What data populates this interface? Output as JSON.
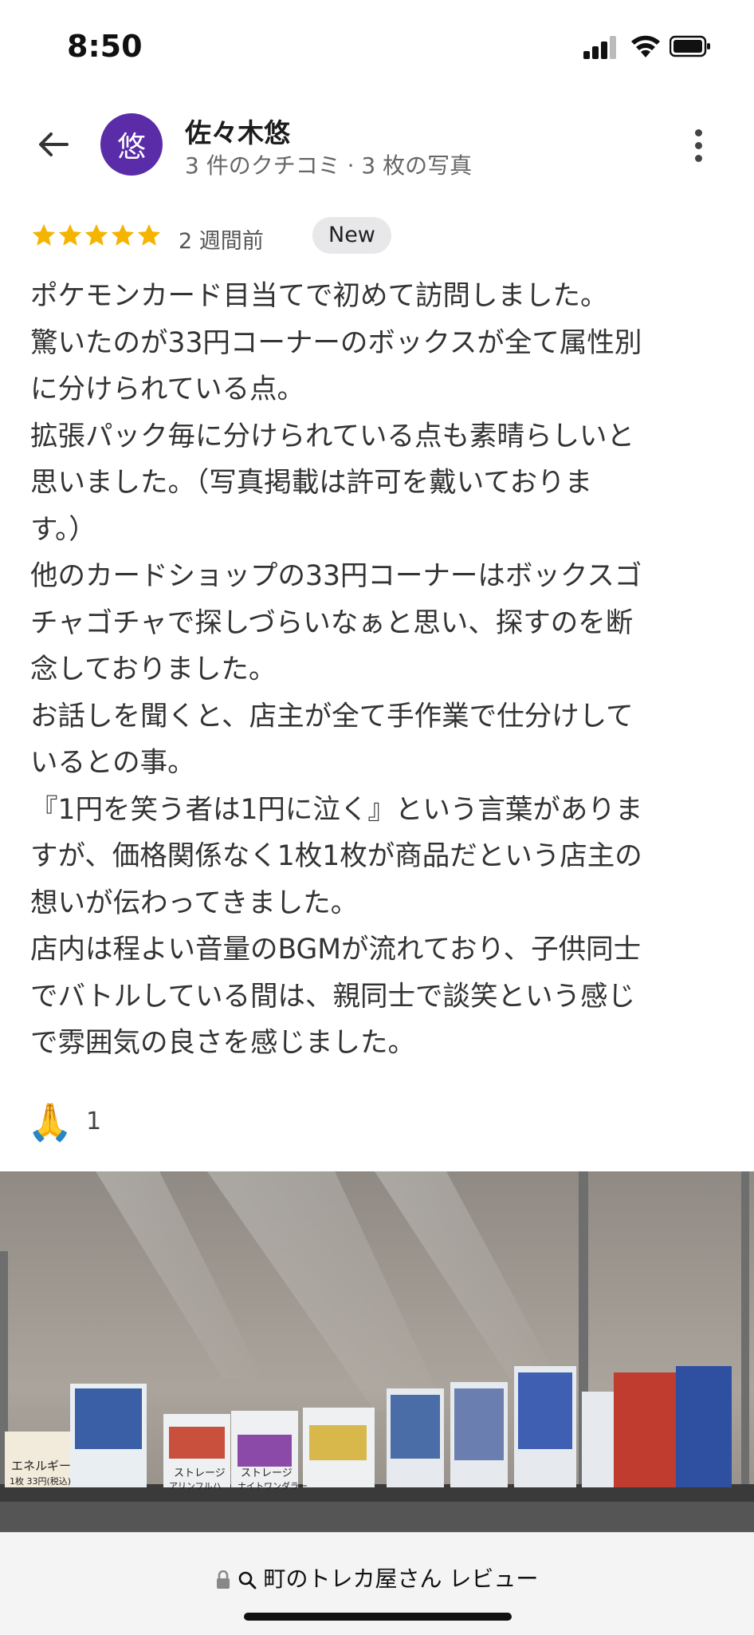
{
  "status": {
    "time": "8:50"
  },
  "header": {
    "avatar_letter": "悠",
    "user_name": "佐々木悠",
    "user_meta": "3 件のクチコミ · 3 枚の写真"
  },
  "review": {
    "rating": 5,
    "time_ago": "2 週間前",
    "badge": "New",
    "lines": [
      "ポケモンカード目当てで初めて訪問しました。",
      "驚いたのが33円コーナーのボックスが全て属性別",
      "に分けられている点。",
      "拡張パック毎に分けられている点も素晴らしいと",
      "思いました。（写真掲載は許可を戴いておりま",
      "す。）",
      "他のカードショップの33円コーナーはボックスゴ",
      "チャゴチャで探しづらいなぁと思い、探すのを断",
      "念しておりました。",
      "お話しを聞くと、店主が全て手作業で仕分けして",
      "いるとの事。",
      "『1円を笑う者は1円に泣く』という言葉がありま",
      "すが、価格関係なく1枚1枚が商品だという店主の",
      "想いが伝わってきました。",
      "店内は程よい音量のBGMが流れており、子供同士",
      "でバトルしている間は、親同士で談笑という感じ",
      "で雰囲気の良さを感じました。"
    ],
    "reaction_emoji": "🙏",
    "reaction_count": "1"
  },
  "photo": {
    "labels": [
      "エネルギー",
      "1枚 33円(税込)",
      "ストレージ",
      "アリンフルハ",
      "ストレージ",
      "ナイトワンダラー"
    ]
  },
  "bottom_bar": {
    "url": "町のトレカ屋さん レビュー"
  },
  "colors": {
    "avatar": "#5a2ca8",
    "star": "#f4b400",
    "badge_bg": "#e8e8ea"
  },
  "icons": [
    "back-arrow-icon",
    "more-vert-icon",
    "star-icon",
    "lock-icon",
    "search-icon",
    "signal-icon",
    "wifi-icon",
    "battery-icon"
  ]
}
